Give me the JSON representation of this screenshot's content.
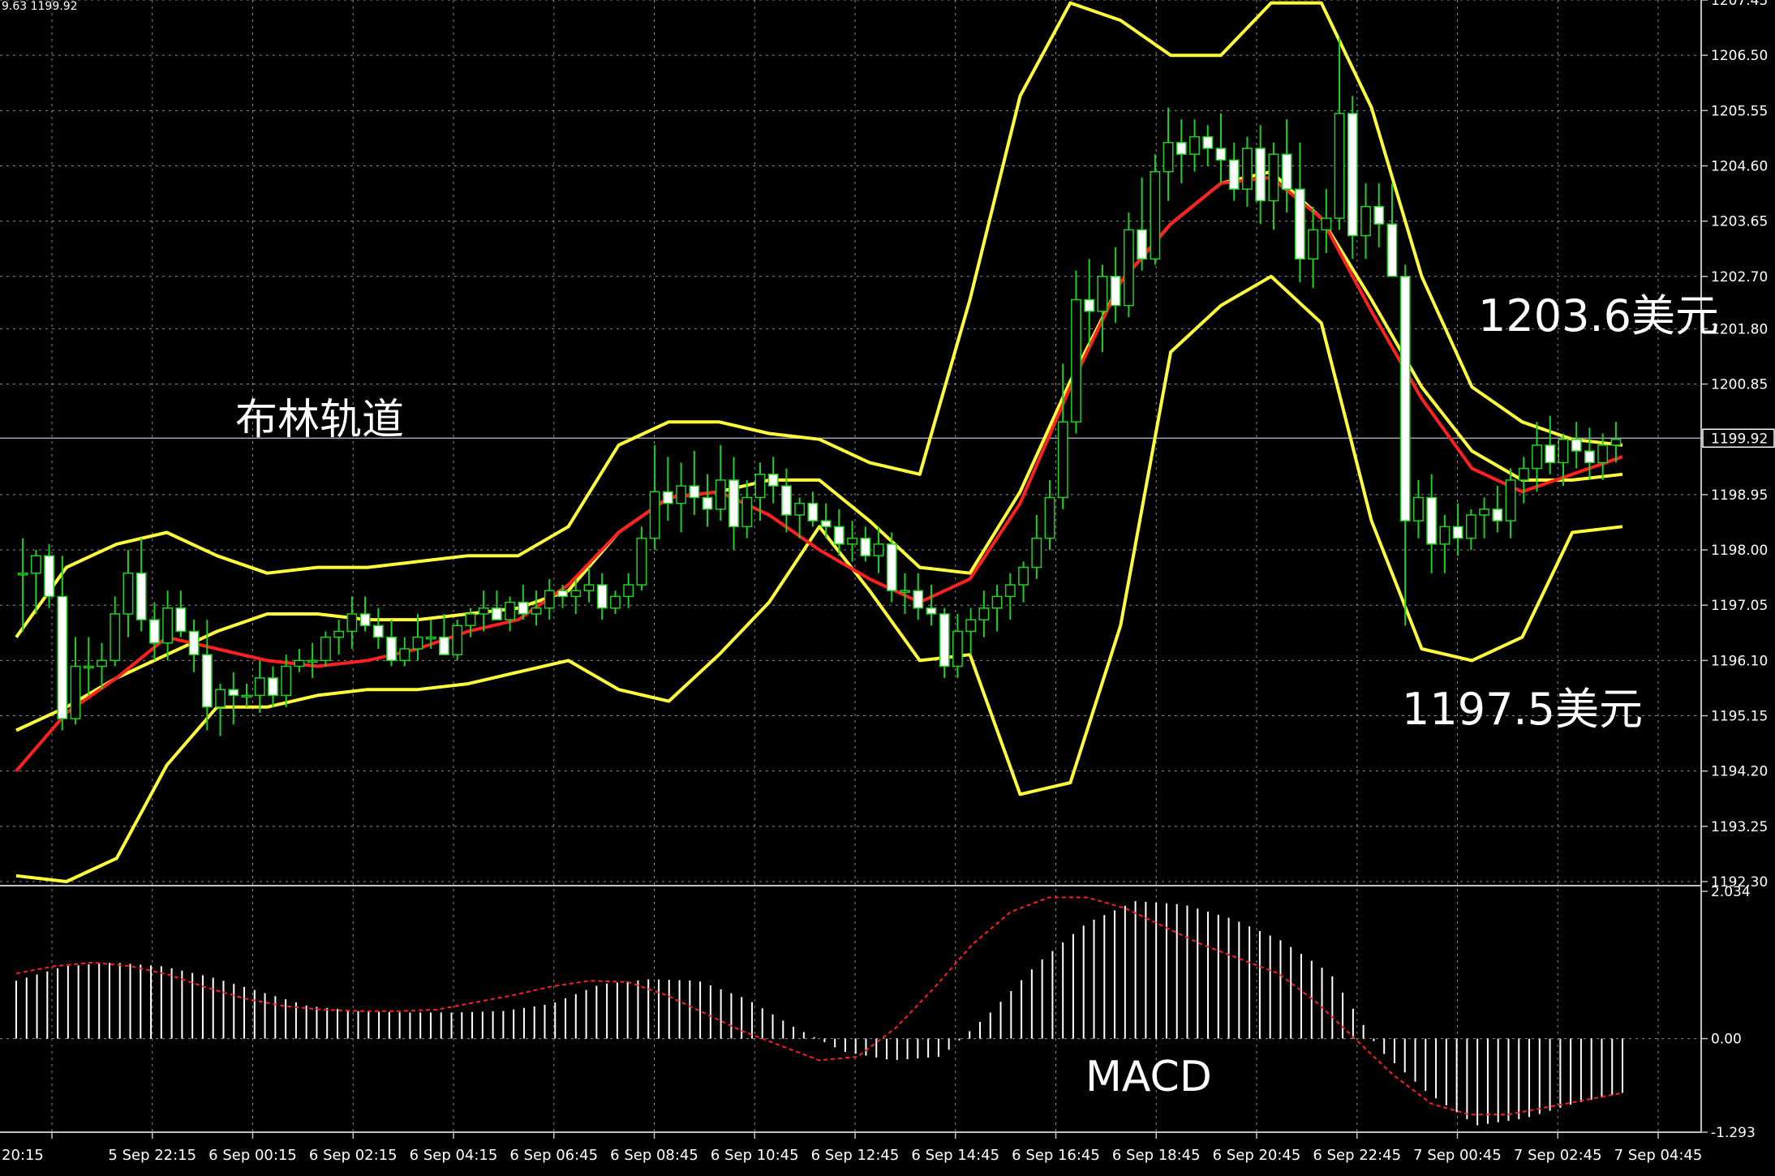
{
  "header": {
    "text": "9.63 1199.92"
  },
  "annotations": {
    "bollinger": "布林轨道",
    "upper_price": "1203.6美元",
    "lower_price": "1197.5美元",
    "macd": "MACD"
  },
  "colors": {
    "background": "#000000",
    "grid": "#8c8c8c",
    "axis": "#c0c0c0",
    "text": "#ffffff",
    "bollinger": "#ffff3c",
    "ma": "#ff2020",
    "bull": "#20d020",
    "bear": "#ffffff",
    "macd_hist": "#ffffff",
    "macd_signal": "#ff2020"
  },
  "chart_data": [
    {
      "type": "candlestick",
      "pane": "price",
      "current_price": 1199.92,
      "ylim": [
        1192.3,
        1207.45
      ],
      "yticks": [
        "1207.45",
        "1206.50",
        "1205.55",
        "1204.60",
        "1203.65",
        "1202.70",
        "1201.80",
        "1200.85",
        "1199.92",
        "1198.95",
        "1198.00",
        "1197.05",
        "1196.10",
        "1195.15",
        "1194.20",
        "1193.25",
        "1192.30"
      ],
      "xticks": [
        "20:15",
        "5 Sep 22:15",
        "6 Sep 00:15",
        "6 Sep 02:15",
        "6 Sep 04:15",
        "6 Sep 06:45",
        "6 Sep 08:45",
        "6 Sep 10:45",
        "6 Sep 12:45",
        "6 Sep 14:45",
        "6 Sep 16:45",
        "6 Sep 18:45",
        "6 Sep 20:45",
        "6 Sep 22:45",
        "7 Sep 00:45",
        "7 Sep 02:45",
        "7 Sep 04:45"
      ],
      "indicator_points_x": [
        0,
        0.5,
        1,
        1.5,
        2,
        2.5,
        3,
        3.5,
        4,
        4.5,
        5,
        5.5,
        6,
        6.5,
        7,
        7.5,
        8,
        8.5,
        9,
        9.5,
        10,
        10.5,
        11,
        11.5,
        12,
        12.5,
        13,
        13.5,
        14,
        14.5,
        15,
        15.5,
        16
      ],
      "bollinger_upper": [
        1196.5,
        1197.7,
        1198.1,
        1198.3,
        1197.9,
        1197.6,
        1197.7,
        1197.7,
        1197.8,
        1197.9,
        1197.9,
        1198.4,
        1199.8,
        1200.2,
        1200.2,
        1200.0,
        1199.9,
        1199.5,
        1199.3,
        1202.3,
        1205.8,
        1207.4,
        1207.1,
        1206.5,
        1206.5,
        1207.4,
        1207.4,
        1205.6,
        1202.7,
        1200.8,
        1200.2,
        1199.9,
        1199.8
      ],
      "bollinger_middle": [
        1194.9,
        1195.3,
        1195.8,
        1196.2,
        1196.6,
        1196.9,
        1196.9,
        1196.8,
        1196.8,
        1196.9,
        1197.0,
        1197.3,
        1198.3,
        1198.9,
        1199.0,
        1199.2,
        1199.2,
        1198.5,
        1197.7,
        1197.6,
        1199.0,
        1200.9,
        1202.6,
        1203.6,
        1204.3,
        1204.5,
        1203.7,
        1202.3,
        1200.8,
        1199.7,
        1199.2,
        1199.2,
        1199.3
      ],
      "bollinger_lower": [
        1192.4,
        1192.3,
        1192.7,
        1194.3,
        1195.3,
        1195.3,
        1195.5,
        1195.6,
        1195.6,
        1195.7,
        1195.9,
        1196.1,
        1195.6,
        1195.4,
        1196.2,
        1197.1,
        1198.4,
        1197.3,
        1196.1,
        1196.2,
        1193.8,
        1194.0,
        1196.7,
        1201.4,
        1202.2,
        1202.7,
        1201.9,
        1198.5,
        1196.3,
        1196.1,
        1196.5,
        1198.3,
        1198.4
      ],
      "moving_average": [
        1194.2,
        1195.2,
        1195.8,
        1196.5,
        1196.3,
        1196.1,
        1196.0,
        1196.1,
        1196.3,
        1196.6,
        1196.8,
        1197.4,
        1198.3,
        1198.9,
        1199.0,
        1198.6,
        1198.0,
        1197.5,
        1197.1,
        1197.5,
        1198.8,
        1200.8,
        1202.6,
        1203.6,
        1204.3,
        1204.4,
        1203.7,
        1202.1,
        1200.6,
        1199.4,
        1199.0,
        1199.3,
        1199.6
      ],
      "candles_ohlc": [
        [
          1197.6,
          1198.2,
          1196.6,
          1197.6
        ],
        [
          1197.6,
          1198.0,
          1196.9,
          1197.9
        ],
        [
          1197.9,
          1198.1,
          1197.0,
          1197.2
        ],
        [
          1197.2,
          1197.9,
          1194.9,
          1195.1
        ],
        [
          1195.1,
          1196.5,
          1195.0,
          1196.0
        ],
        [
          1196.0,
          1196.5,
          1195.5,
          1196.0
        ],
        [
          1196.0,
          1196.4,
          1195.6,
          1196.1
        ],
        [
          1196.1,
          1197.2,
          1196.0,
          1196.9
        ],
        [
          1196.9,
          1198.0,
          1196.5,
          1197.6
        ],
        [
          1197.6,
          1198.2,
          1196.6,
          1196.8
        ],
        [
          1196.8,
          1197.1,
          1196.1,
          1196.4
        ],
        [
          1196.4,
          1197.3,
          1196.1,
          1197.0
        ],
        [
          1197.0,
          1197.3,
          1196.5,
          1196.6
        ],
        [
          1196.6,
          1196.8,
          1195.9,
          1196.2
        ],
        [
          1196.2,
          1196.8,
          1194.9,
          1195.3
        ],
        [
          1195.3,
          1195.7,
          1194.8,
          1195.6
        ],
        [
          1195.6,
          1195.9,
          1195.0,
          1195.5
        ],
        [
          1195.5,
          1195.7,
          1195.3,
          1195.5
        ],
        [
          1195.5,
          1196.1,
          1195.2,
          1195.8
        ],
        [
          1195.8,
          1196.0,
          1195.3,
          1195.5
        ],
        [
          1195.5,
          1196.2,
          1195.3,
          1196.0
        ],
        [
          1196.0,
          1196.3,
          1195.9,
          1196.1
        ],
        [
          1196.1,
          1196.4,
          1195.8,
          1196.1
        ],
        [
          1196.1,
          1196.6,
          1196.0,
          1196.5
        ],
        [
          1196.5,
          1196.8,
          1196.2,
          1196.6
        ],
        [
          1196.6,
          1197.2,
          1196.3,
          1196.9
        ],
        [
          1196.9,
          1197.2,
          1196.6,
          1196.7
        ],
        [
          1196.7,
          1197.0,
          1196.3,
          1196.5
        ],
        [
          1196.5,
          1196.8,
          1196.0,
          1196.1
        ],
        [
          1196.1,
          1196.5,
          1196.0,
          1196.3
        ],
        [
          1196.3,
          1196.9,
          1196.1,
          1196.5
        ],
        [
          1196.5,
          1196.8,
          1196.3,
          1196.5
        ],
        [
          1196.5,
          1196.9,
          1196.2,
          1196.2
        ],
        [
          1196.2,
          1196.8,
          1196.1,
          1196.7
        ],
        [
          1196.7,
          1197.0,
          1196.5,
          1196.9
        ],
        [
          1196.9,
          1197.3,
          1196.6,
          1197.0
        ],
        [
          1197.0,
          1197.3,
          1196.8,
          1196.8
        ],
        [
          1196.8,
          1197.2,
          1196.6,
          1197.1
        ],
        [
          1197.1,
          1197.4,
          1196.8,
          1196.9
        ],
        [
          1196.9,
          1197.3,
          1196.7,
          1197.0
        ],
        [
          1197.0,
          1197.5,
          1196.8,
          1197.3
        ],
        [
          1197.3,
          1197.4,
          1197.0,
          1197.2
        ],
        [
          1197.2,
          1197.5,
          1196.9,
          1197.3
        ],
        [
          1197.3,
          1197.7,
          1197.1,
          1197.4
        ],
        [
          1197.4,
          1197.6,
          1196.8,
          1197.0
        ],
        [
          1197.0,
          1197.3,
          1196.9,
          1197.2
        ],
        [
          1197.2,
          1197.6,
          1197.0,
          1197.4
        ],
        [
          1197.4,
          1198.4,
          1197.3,
          1198.2
        ],
        [
          1198.2,
          1199.8,
          1198.0,
          1199.0
        ],
        [
          1199.0,
          1199.6,
          1198.5,
          1198.8
        ],
        [
          1198.8,
          1199.5,
          1198.3,
          1199.1
        ],
        [
          1199.1,
          1199.7,
          1198.6,
          1198.9
        ],
        [
          1198.9,
          1199.3,
          1198.4,
          1198.7
        ],
        [
          1198.7,
          1199.8,
          1198.5,
          1199.2
        ],
        [
          1199.2,
          1199.6,
          1198.0,
          1198.4
        ],
        [
          1198.4,
          1199.2,
          1198.2,
          1198.9
        ],
        [
          1198.9,
          1199.5,
          1198.5,
          1199.3
        ],
        [
          1199.3,
          1199.6,
          1198.8,
          1199.1
        ],
        [
          1199.1,
          1199.4,
          1198.3,
          1198.6
        ],
        [
          1198.6,
          1198.9,
          1198.2,
          1198.8
        ],
        [
          1198.8,
          1199.0,
          1198.4,
          1198.5
        ],
        [
          1198.5,
          1198.8,
          1198.2,
          1198.4
        ],
        [
          1198.4,
          1198.7,
          1197.9,
          1198.1
        ],
        [
          1198.1,
          1198.5,
          1197.8,
          1198.2
        ],
        [
          1198.2,
          1198.4,
          1197.8,
          1197.9
        ],
        [
          1197.9,
          1198.4,
          1197.6,
          1198.1
        ],
        [
          1198.1,
          1198.3,
          1197.1,
          1197.3
        ],
        [
          1197.3,
          1197.6,
          1196.9,
          1197.3
        ],
        [
          1197.3,
          1197.6,
          1196.8,
          1197.0
        ],
        [
          1197.0,
          1197.4,
          1196.7,
          1196.9
        ],
        [
          1196.9,
          1197.0,
          1195.8,
          1196.0
        ],
        [
          1196.0,
          1196.9,
          1195.8,
          1196.6
        ],
        [
          1196.6,
          1197.0,
          1196.2,
          1196.8
        ],
        [
          1196.8,
          1197.3,
          1196.5,
          1197.0
        ],
        [
          1197.0,
          1197.4,
          1196.6,
          1197.2
        ],
        [
          1197.2,
          1197.6,
          1196.8,
          1197.4
        ],
        [
          1197.4,
          1197.8,
          1197.1,
          1197.7
        ],
        [
          1197.7,
          1198.6,
          1197.5,
          1198.2
        ],
        [
          1198.2,
          1199.2,
          1198.0,
          1198.9
        ],
        [
          1198.9,
          1201.2,
          1198.7,
          1200.2
        ],
        [
          1200.2,
          1202.8,
          1200.0,
          1202.3
        ],
        [
          1202.3,
          1203.0,
          1201.5,
          1202.1
        ],
        [
          1202.1,
          1202.9,
          1201.4,
          1202.7
        ],
        [
          1202.7,
          1203.2,
          1201.9,
          1202.2
        ],
        [
          1202.2,
          1203.8,
          1202.0,
          1203.5
        ],
        [
          1203.5,
          1204.4,
          1202.8,
          1203.0
        ],
        [
          1203.0,
          1204.8,
          1202.9,
          1204.5
        ],
        [
          1204.5,
          1205.6,
          1204.0,
          1205.0
        ],
        [
          1205.0,
          1205.4,
          1204.3,
          1204.8
        ],
        [
          1204.8,
          1205.4,
          1204.5,
          1205.1
        ],
        [
          1205.1,
          1205.3,
          1204.6,
          1204.9
        ],
        [
          1204.9,
          1205.5,
          1204.3,
          1204.7
        ],
        [
          1204.7,
          1205.0,
          1204.0,
          1204.2
        ],
        [
          1204.2,
          1205.1,
          1203.9,
          1204.9
        ],
        [
          1204.9,
          1205.3,
          1203.6,
          1204.0
        ],
        [
          1204.0,
          1205.0,
          1203.5,
          1204.8
        ],
        [
          1204.8,
          1205.4,
          1203.8,
          1204.2
        ],
        [
          1204.2,
          1205.0,
          1202.6,
          1203.0
        ],
        [
          1203.0,
          1203.9,
          1202.5,
          1203.5
        ],
        [
          1203.5,
          1204.2,
          1203.1,
          1203.7
        ],
        [
          1203.7,
          1206.8,
          1203.5,
          1205.5
        ],
        [
          1205.5,
          1205.8,
          1203.0,
          1203.4
        ],
        [
          1203.4,
          1204.3,
          1203.0,
          1203.9
        ],
        [
          1203.9,
          1204.3,
          1203.2,
          1203.6
        ],
        [
          1203.6,
          1204.3,
          1203.2,
          1202.7
        ],
        [
          1202.7,
          1202.9,
          1196.7,
          1198.5
        ],
        [
          1198.5,
          1199.2,
          1198.2,
          1198.9
        ],
        [
          1198.9,
          1199.3,
          1197.6,
          1198.1
        ],
        [
          1198.1,
          1198.6,
          1197.6,
          1198.4
        ],
        [
          1198.4,
          1198.8,
          1197.9,
          1198.2
        ],
        [
          1198.2,
          1198.7,
          1198.0,
          1198.6
        ],
        [
          1198.6,
          1198.9,
          1198.2,
          1198.7
        ],
        [
          1198.7,
          1199.1,
          1198.3,
          1198.5
        ],
        [
          1198.5,
          1199.4,
          1198.2,
          1199.2
        ],
        [
          1199.2,
          1199.6,
          1198.8,
          1199.4
        ],
        [
          1199.4,
          1200.2,
          1199.0,
          1199.8
        ],
        [
          1199.8,
          1200.3,
          1199.3,
          1199.5
        ],
        [
          1199.5,
          1200.0,
          1199.1,
          1199.9
        ],
        [
          1199.9,
          1200.2,
          1199.4,
          1199.7
        ],
        [
          1199.7,
          1200.1,
          1199.2,
          1199.5
        ],
        [
          1199.5,
          1200.0,
          1199.2,
          1199.8
        ],
        [
          1199.8,
          1200.2,
          1199.5,
          1199.9
        ]
      ]
    },
    {
      "type": "bar+line",
      "pane": "macd",
      "ylim": [
        -1.293,
        2.034
      ],
      "yticks": [
        "2.034",
        "0.00",
        "-1.293"
      ],
      "histogram": [
        0.8,
        1.0,
        1.05,
        1.0,
        0.85,
        0.65,
        0.45,
        0.38,
        0.36,
        0.36,
        0.38,
        0.48,
        0.75,
        0.82,
        0.8,
        0.55,
        0.15,
        -0.18,
        -0.3,
        -0.25,
        0.35,
        1.05,
        1.6,
        1.9,
        1.85,
        1.65,
        1.35,
        0.9,
        -0.15,
        -0.75,
        -1.2,
        -1.1,
        -0.9,
        -0.75
      ],
      "signal": [
        0.9,
        1.0,
        1.05,
        1.0,
        0.88,
        0.7,
        0.55,
        0.45,
        0.4,
        0.38,
        0.38,
        0.4,
        0.5,
        0.6,
        0.72,
        0.8,
        0.78,
        0.6,
        0.35,
        0.1,
        -0.1,
        -0.3,
        -0.25,
        0.15,
        0.7,
        1.3,
        1.75,
        1.95,
        1.95,
        1.8,
        1.55,
        1.3,
        1.1,
        0.9,
        0.5,
        0.0,
        -0.5,
        -0.9,
        -1.05,
        -1.05,
        -0.95,
        -0.85,
        -0.75
      ]
    }
  ]
}
